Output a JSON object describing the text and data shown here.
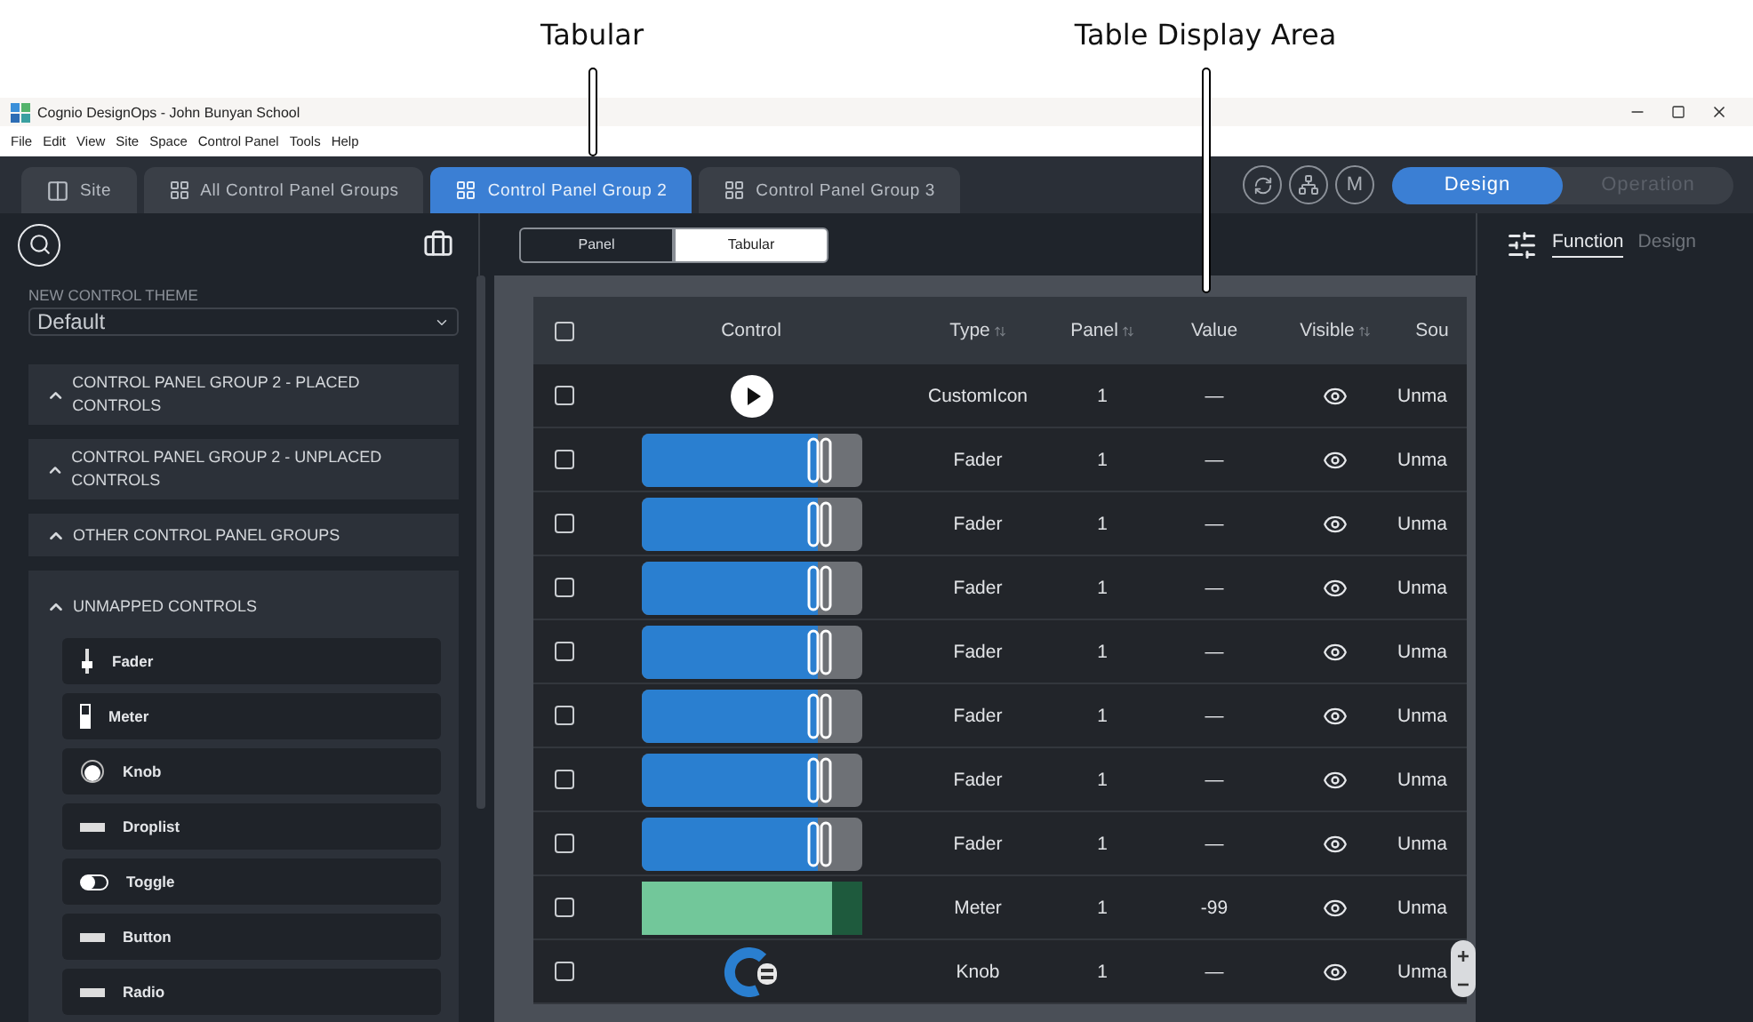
{
  "callouts": [
    {
      "label": "Tabular"
    },
    {
      "label": "Table Display Area"
    }
  ],
  "window": {
    "title": "Cognio DesignOps - John Bunyan School"
  },
  "menu": [
    "File",
    "Edit",
    "View",
    "Site",
    "Space",
    "Control Panel",
    "Tools",
    "Help"
  ],
  "tabs": [
    {
      "label": "Site",
      "kind": "site",
      "selected": false
    },
    {
      "label": "All Control Panel Groups",
      "kind": "group",
      "selected": false
    },
    {
      "label": "Control Panel Group 2",
      "kind": "group",
      "selected": true
    },
    {
      "label": "Control Panel Group 3",
      "kind": "group",
      "selected": false
    }
  ],
  "profile_badge": "M",
  "mode_switch": [
    {
      "label": "Design",
      "selected": true
    },
    {
      "label": "Operation",
      "selected": false
    }
  ],
  "view_switch": [
    {
      "label": "Panel",
      "selected": false
    },
    {
      "label": "Tabular",
      "selected": true
    }
  ],
  "right_panel": {
    "tabs": [
      {
        "label": "Function",
        "selected": true
      },
      {
        "label": "Design",
        "selected": false
      }
    ]
  },
  "sidebar": {
    "theme_label": "NEW CONTROL THEME",
    "theme_value": "Default",
    "groups": [
      {
        "title": "CONTROL PANEL GROUP 2 - PLACED CONTROLS"
      },
      {
        "title": "CONTROL PANEL GROUP 2 - UNPLACED CONTROLS"
      },
      {
        "title": "OTHER CONTROL PANEL GROUPS"
      },
      {
        "title": "UNMAPPED CONTROLS",
        "items": [
          {
            "label": "Fader",
            "kind": "fader"
          },
          {
            "label": "Meter",
            "kind": "meter"
          },
          {
            "label": "Knob",
            "kind": "knob"
          },
          {
            "label": "Droplist",
            "kind": "droplist"
          },
          {
            "label": "Toggle",
            "kind": "toggle"
          },
          {
            "label": "Button",
            "kind": "button"
          },
          {
            "label": "Radio",
            "kind": "radio"
          }
        ]
      }
    ]
  },
  "table": {
    "select_all_checked": false,
    "columns": [
      {
        "label": "Control",
        "sortable": false
      },
      {
        "label": "Type",
        "sortable": true
      },
      {
        "label": "Panel",
        "sortable": true
      },
      {
        "label": "Value",
        "sortable": false
      },
      {
        "label": "Visible",
        "sortable": true
      },
      {
        "label": "Sou",
        "sortable": false
      }
    ],
    "rows": [
      {
        "checked": false,
        "kind": "custom_icon",
        "type": "CustomIcon",
        "panel": "1",
        "value": "—",
        "visible": true,
        "source": "Unma"
      },
      {
        "checked": false,
        "kind": "fader",
        "level": 0.8,
        "type": "Fader",
        "panel": "1",
        "value": "—",
        "visible": true,
        "source": "Unma"
      },
      {
        "checked": false,
        "kind": "fader",
        "level": 0.8,
        "type": "Fader",
        "panel": "1",
        "value": "—",
        "visible": true,
        "source": "Unma"
      },
      {
        "checked": false,
        "kind": "fader",
        "level": 0.8,
        "type": "Fader",
        "panel": "1",
        "value": "—",
        "visible": true,
        "source": "Unma"
      },
      {
        "checked": false,
        "kind": "fader",
        "level": 0.8,
        "type": "Fader",
        "panel": "1",
        "value": "—",
        "visible": true,
        "source": "Unma"
      },
      {
        "checked": false,
        "kind": "fader",
        "level": 0.8,
        "type": "Fader",
        "panel": "1",
        "value": "—",
        "visible": true,
        "source": "Unma"
      },
      {
        "checked": false,
        "kind": "fader",
        "level": 0.8,
        "type": "Fader",
        "panel": "1",
        "value": "—",
        "visible": true,
        "source": "Unma"
      },
      {
        "checked": false,
        "kind": "fader",
        "level": 0.8,
        "type": "Fader",
        "panel": "1",
        "value": "—",
        "visible": true,
        "source": "Unma"
      },
      {
        "checked": false,
        "kind": "meter",
        "level": 0.87,
        "type": "Meter",
        "panel": "1",
        "value": "-99",
        "visible": true,
        "source": "Unma"
      },
      {
        "checked": false,
        "kind": "knob",
        "type": "Knob",
        "panel": "1",
        "value": "—",
        "visible": true,
        "source": "Unma"
      }
    ]
  }
}
